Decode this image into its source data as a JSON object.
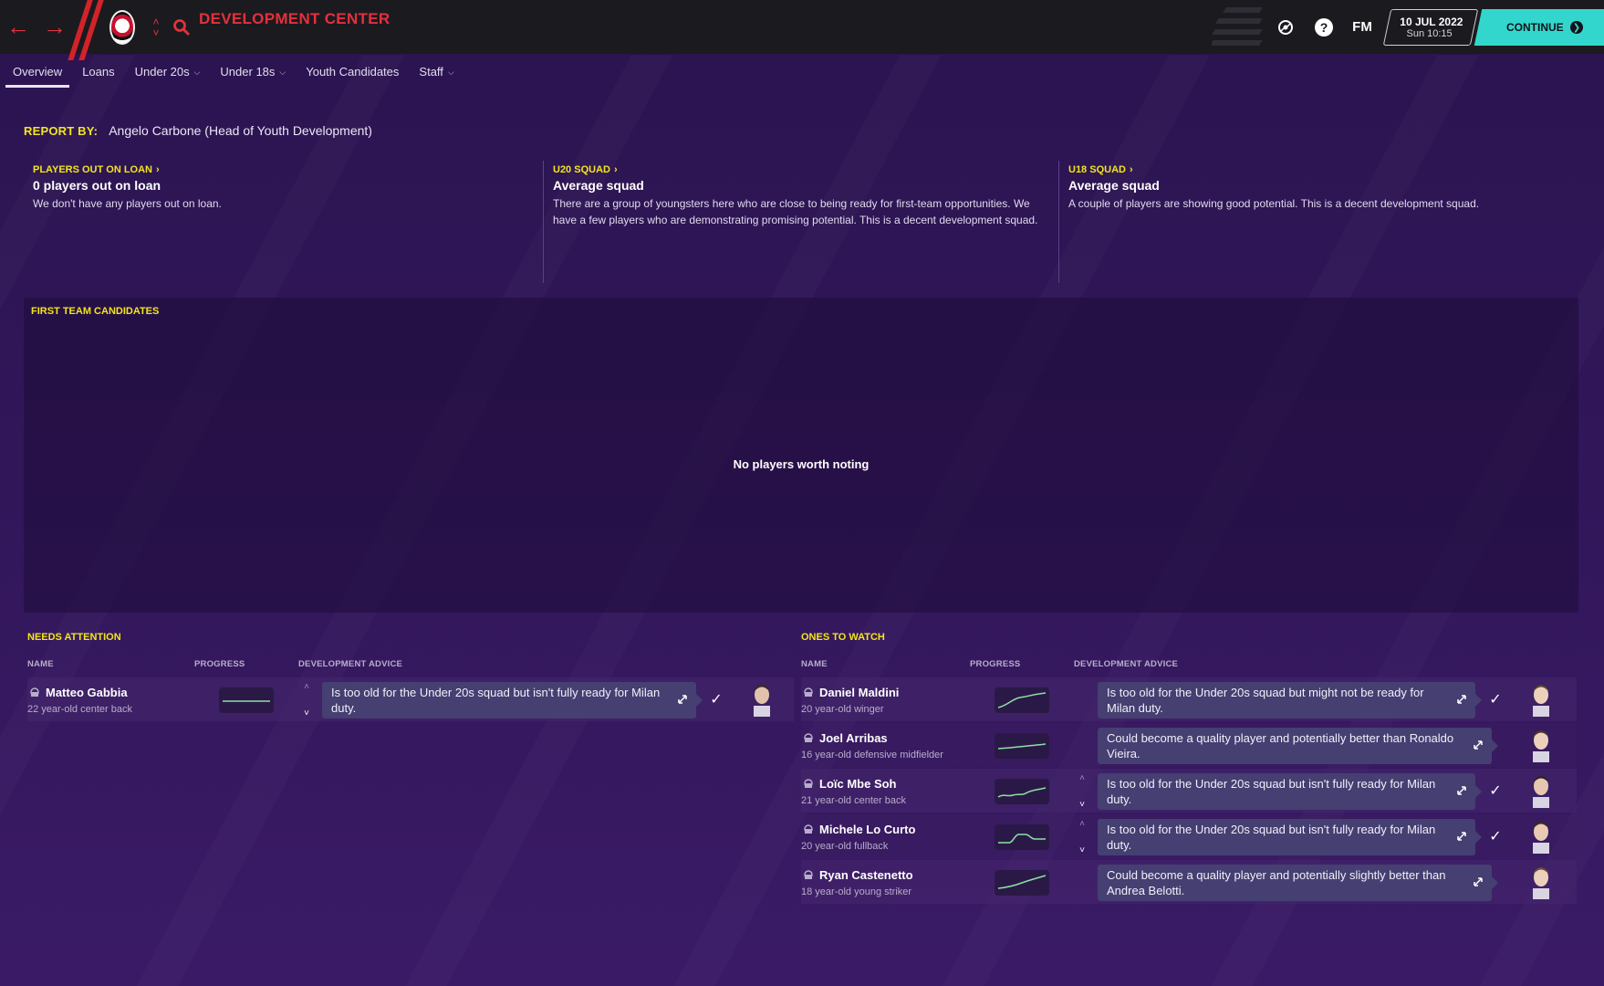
{
  "topbar": {
    "title": "DEVELOPMENT CENTER",
    "fm_label": "FM",
    "help_label": "?",
    "date": "10 JUL 2022",
    "time": "Sun 10:15",
    "continue_label": "CONTINUE"
  },
  "tabs": [
    {
      "label": "Overview",
      "active": true
    },
    {
      "label": "Loans"
    },
    {
      "label": "Under 20s",
      "dropdown": true
    },
    {
      "label": "Under 18s",
      "dropdown": true
    },
    {
      "label": "Youth Candidates"
    },
    {
      "label": "Staff",
      "dropdown": true
    }
  ],
  "report": {
    "label": "REPORT BY:",
    "name": "Angelo Carbone (Head of Youth Development)"
  },
  "summary": [
    {
      "heading": "PLAYERS OUT ON LOAN",
      "title": "0 players out on loan",
      "text": "We don't have any players out on loan."
    },
    {
      "heading": "U20 SQUAD",
      "title": "Average squad",
      "text": "There are a group of youngsters here who are close to being ready for first-team opportunities. We have a few players who are demonstrating promising potential. This is a decent development squad."
    },
    {
      "heading": "U18 SQUAD",
      "title": "Average squad",
      "text": "A couple of players are showing good potential. This is a decent development squad."
    }
  ],
  "first_team": {
    "heading": "FIRST TEAM CANDIDATES",
    "empty_text": "No players worth noting"
  },
  "needs_attention": {
    "heading": "NEEDS ATTENTION",
    "columns": {
      "name": "NAME",
      "progress": "PROGRESS",
      "advice": "DEVELOPMENT ADVICE"
    },
    "rows": [
      {
        "name": "Matteo Gabbia",
        "sub": "22 year-old center back",
        "advice": "Is too old for the Under 20s squad but isn't fully ready for Milan duty."
      }
    ]
  },
  "ones_to_watch": {
    "heading": "ONES TO WATCH",
    "columns": {
      "name": "NAME",
      "progress": "PROGRESS",
      "advice": "DEVELOPMENT ADVICE"
    },
    "rows": [
      {
        "name": "Daniel Maldini",
        "sub": "20 year-old winger",
        "advice": "Is too old for the Under 20s squad but might not be ready for Milan duty."
      },
      {
        "name": "Joel Arribas",
        "sub": "16 year-old defensive midfielder",
        "advice": "Could become a quality player and potentially better than Ronaldo Vieira."
      },
      {
        "name": "Loïc Mbe Soh",
        "sub": "21 year-old center back",
        "advice": "Is too old for the Under 20s squad but isn't fully ready for Milan duty."
      },
      {
        "name": "Michele Lo Curto",
        "sub": "20 year-old fullback",
        "advice": "Is too old for the Under 20s squad but isn't fully ready for Milan duty."
      },
      {
        "name": "Ryan Castenetto",
        "sub": "18 year-old young striker",
        "advice": "Could become a quality player and potentially slightly better than Andrea Belotti."
      }
    ]
  },
  "colors": {
    "accent_yellow": "#f2e51d",
    "title_red": "#e3313c",
    "continue_teal": "#33d6cc",
    "background_purple": "#311659"
  },
  "icons": [
    "back-arrow-icon",
    "forward-arrow-icon",
    "club-badge-icon",
    "search-icon",
    "network-icon",
    "help-icon",
    "expand-icon",
    "check-icon",
    "player-face-icon"
  ]
}
